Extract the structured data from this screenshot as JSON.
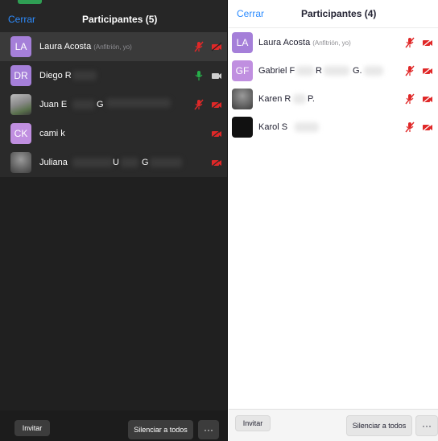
{
  "left_panel": {
    "close_label": "Cerrar",
    "title": "Participantes (5)",
    "participants": [
      {
        "initials": "LA",
        "name": "Laura Acosta",
        "tag": "(Anfitrión, yo)"
      },
      {
        "initials": "DR",
        "name": "Diego R"
      },
      {
        "initials": "",
        "name": "Juan E",
        "mid": "G"
      },
      {
        "initials": "CK",
        "name": "cami k"
      },
      {
        "initials": "",
        "name": "Juliana",
        "mid": "U",
        "last": "G"
      }
    ],
    "footer": {
      "invite_label": "Invitar",
      "mute_all_label": "Silenciar a todos",
      "more_label": "···"
    }
  },
  "right_panel": {
    "close_label": "Cerrar",
    "title": "Participantes (4)",
    "participants": [
      {
        "initials": "LA",
        "name": "Laura Acosta",
        "tag": "(Anfitrión, yo)"
      },
      {
        "initials": "GF",
        "name": "Gabriel F",
        "mid": "R",
        "last": "G."
      },
      {
        "initials": "",
        "name": "Karen R",
        "mid": "P."
      },
      {
        "initials": "",
        "name": "Karol S"
      }
    ],
    "footer": {
      "invite_label": "Invitar",
      "mute_all_label": "Silenciar a todos",
      "more_label": "···"
    }
  },
  "colors": {
    "accent": "#2d8cff",
    "muted_red": "#e02828",
    "mic_on_green": "#26b04a",
    "avatar_purple": "#a57fd9"
  },
  "icons": {
    "muted_mic": "muted-microphone-icon",
    "active_mic": "microphone-icon",
    "video_off": "video-off-icon",
    "video_on": "video-camera-icon"
  }
}
